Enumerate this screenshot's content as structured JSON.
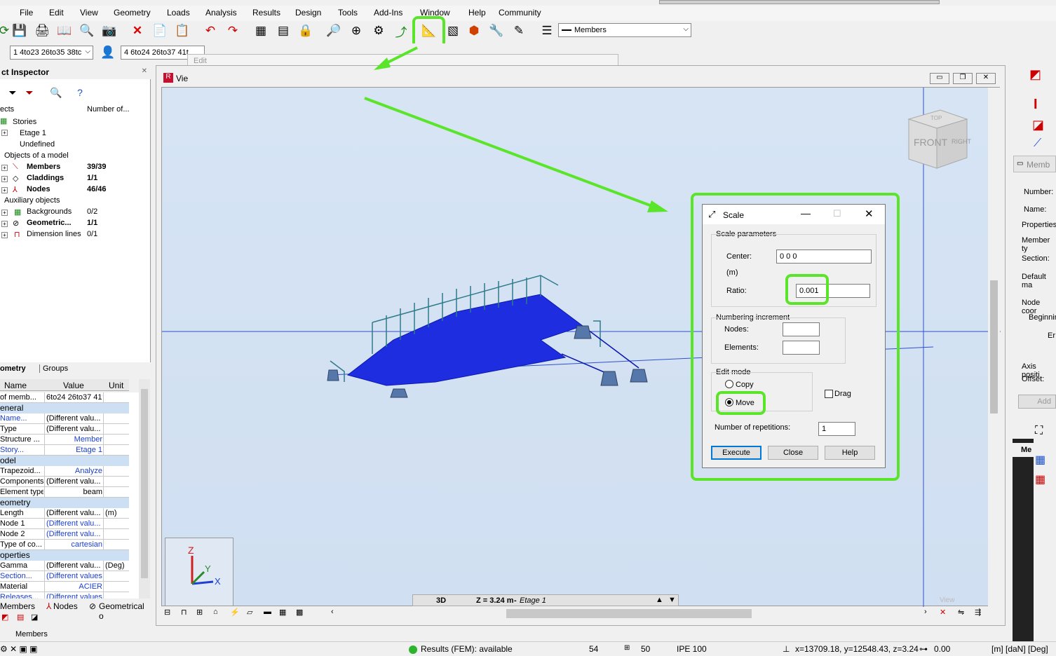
{
  "menu": [
    "File",
    "Edit",
    "View",
    "Geometry",
    "Loads",
    "Analysis",
    "Results",
    "Design",
    "Tools",
    "Add-Ins",
    "Window",
    "Help",
    "Community"
  ],
  "toolbar": {
    "members_combo": "Members",
    "selection_combo_1": "1 4to23 26to35 38tc",
    "selection_combo_2": "4 6to24 26to37 41t",
    "edit_toolbar_label": "Edit"
  },
  "inspector": {
    "title": "ct Inspector",
    "col_objects": "ects",
    "col_number": "Number of...",
    "stories": "Stories",
    "etage": "Etage 1",
    "undefined": "Undefined",
    "objects_of_model": "Objects of a model",
    "members": "Members",
    "members_count": "39/39",
    "claddings": "Claddings",
    "claddings_count": "1/1",
    "nodes": "Nodes",
    "nodes_count": "46/46",
    "auxiliary": "Auxiliary objects",
    "backgrounds": "Backgrounds",
    "backgrounds_count": "0/2",
    "geometric": "Geometric...",
    "geometric_count": "1/1",
    "dimension_lines": "Dimension lines",
    "dimension_count": "0/1",
    "tab_geometry": "ometry",
    "tab_groups": "Groups"
  },
  "propgrid": {
    "h_name": "Name",
    "h_value": "Value",
    "h_unit": "Unit",
    "rows": [
      {
        "type": "row",
        "name": "of memb...",
        "value": "6to24 26to37 41to...",
        "unit": "",
        "blue": false
      },
      {
        "type": "sec",
        "name": "eneral"
      },
      {
        "type": "row",
        "name": "Name...",
        "value": "(Different valu...",
        "unit": "",
        "blue": true
      },
      {
        "type": "row",
        "name": "Type",
        "value": "(Different valu...",
        "unit": "",
        "blue": false
      },
      {
        "type": "row",
        "name": "Structure ...",
        "value": "Member",
        "unit": "",
        "blue": false,
        "valblue": true
      },
      {
        "type": "row",
        "name": "Story...",
        "value": "Etage 1",
        "unit": "",
        "blue": true,
        "valblue": true
      },
      {
        "type": "sec",
        "name": "odel"
      },
      {
        "type": "row",
        "name": "Trapezoid...",
        "value": "Analyze",
        "unit": "",
        "blue": false,
        "valblue": true
      },
      {
        "type": "row",
        "name": "Components",
        "value": "(Different valu...",
        "unit": "",
        "blue": false
      },
      {
        "type": "row",
        "name": "Element type",
        "value": "beam",
        "unit": "",
        "blue": false
      },
      {
        "type": "sec",
        "name": "eometry"
      },
      {
        "type": "row",
        "name": "Length",
        "value": "(Different valu...",
        "unit": "(m)",
        "blue": false
      },
      {
        "type": "row",
        "name": "Node 1",
        "value": "(Different valu...",
        "unit": "",
        "blue": false,
        "valblue": true
      },
      {
        "type": "row",
        "name": "Node 2",
        "value": "(Different valu...",
        "unit": "",
        "blue": false,
        "valblue": true
      },
      {
        "type": "row",
        "name": "Type of co...",
        "value": "cartesian",
        "unit": "",
        "blue": false,
        "valblue": true
      },
      {
        "type": "sec",
        "name": "operties"
      },
      {
        "type": "row",
        "name": "Gamma",
        "value": "(Different valu...",
        "unit": "(Deg)",
        "blue": false
      },
      {
        "type": "row",
        "name": "Section...",
        "value": "(Different values)",
        "unit": "",
        "blue": true,
        "valblue": true
      },
      {
        "type": "row",
        "name": "Material",
        "value": "ACIER",
        "unit": "",
        "blue": false,
        "valblue": true
      },
      {
        "type": "row",
        "name": "Releases...",
        "value": "(Different values)",
        "unit": "",
        "blue": true,
        "valblue": true
      }
    ]
  },
  "bottom_tabs": {
    "members": "Members",
    "nodes": "Nodes",
    "geometrical": "Geometrical o"
  },
  "bottom_label": "Members",
  "viewport": {
    "title": "Vie",
    "view_mode": "3D",
    "z_level": "Z = 3.24 m",
    "z_story": "Etage 1",
    "cube_front": "FRONT",
    "cube_right": "RIGHT",
    "cube_top": "TOP",
    "view_label": "View",
    "axis_z": "Z",
    "axis_y": "Y",
    "axis_x": "X"
  },
  "scale_dialog": {
    "title": "Scale",
    "group_params": "Scale parameters",
    "center_label": "Center:",
    "center_value": "0 0 0",
    "unit_label": "(m)",
    "ratio_label": "Ratio:",
    "ratio_value": "0.001",
    "group_numbering": "Numbering increment",
    "nodes_label": "Nodes:",
    "elements_label": "Elements:",
    "group_edit": "Edit mode",
    "copy_label": "Copy",
    "move_label": "Move",
    "drag_label": "Drag",
    "repetitions_label": "Number of repetitions:",
    "repetitions_value": "1",
    "execute": "Execute",
    "close": "Close",
    "help": "Help"
  },
  "right_panel": {
    "title": "Memb",
    "number": "Number:",
    "name": "Name:",
    "properties": "Properties",
    "member_type": "Member ty",
    "section": "Section:",
    "default_mat": "Default ma",
    "node_coord": "Node coor",
    "beginning": "Beginnin",
    "end": "Er",
    "axis_pos": "Axis positi",
    "offset": "Offset:",
    "add": "Add",
    "me": "Me"
  },
  "status": {
    "results": "Results (FEM): available",
    "n1": "54",
    "n2": "50",
    "section": "IPE 100",
    "coords": "x=13709.18, y=12548.43, z=3.24",
    "value": "0.00",
    "units": "[m] [daN] [Deg]"
  },
  "colors": {
    "highlight": "#5be52a",
    "model_blue": "#1f2de0"
  }
}
